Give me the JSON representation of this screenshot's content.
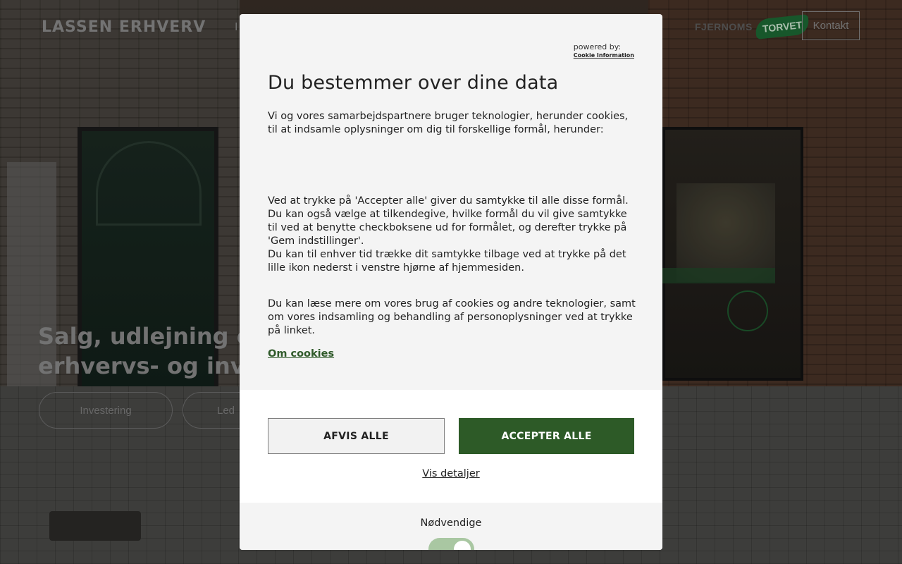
{
  "site": {
    "logo": "LASSEN ERHVERV",
    "nav_first_letter": "I",
    "partner_logo_text": "FJERNOMS",
    "partner_logo_badge": "TORVET",
    "contact_label": "Kontakt",
    "hero_title_line1": "Salg, udlejning og",
    "hero_title_line2": "erhvervs- og inve",
    "pill_1": "Investering",
    "pill_2": "Led"
  },
  "cookie_dialog": {
    "powered_by_label": "powered by:",
    "powered_by_link": "Cookie Information",
    "title": "Du bestemmer over dine data",
    "intro": "Vi og vores samarbejdspartnere bruger teknologier, herunder cookies, til at indsamle oplysninger om dig til forskellige formål, herunder:",
    "consent_line1": "Ved at trykke på 'Accepter alle' giver du samtykke til alle disse formål. Du kan også vælge at tilkendegive, hvilke formål du vil give samtykke til ved at benytte checkboksene ud for formålet, og derefter trykke på 'Gem indstillinger'.",
    "consent_line2": "Du kan til enhver tid trække dit samtykke tilbage ved at trykke på det lille ikon nederst i venstre hjørne af hjemmesiden.",
    "read_more": "Du kan læse mere om vores brug af cookies og andre teknologier, samt om vores indsamling og behandling af personoplysninger ved at trykke på linket.",
    "cookie_link": "Om cookies",
    "reject_label": "AFVIS ALLE",
    "accept_label": "ACCEPTER ALLE",
    "details_label": "Vis detaljer",
    "necessary_label": "Nødvendige",
    "necessary_enabled": true
  },
  "colors": {
    "accent_green": "#2d5a27",
    "toggle_green": "#a9c7a2"
  }
}
